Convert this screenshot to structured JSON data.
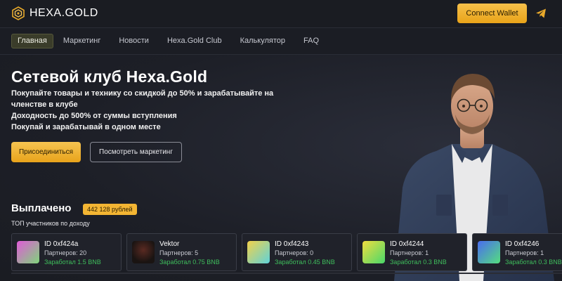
{
  "brand": {
    "name": "HEXA.GOLD",
    "accent": "#f0b030"
  },
  "header": {
    "connect_label": "Connect Wallet"
  },
  "nav": {
    "items": [
      {
        "label": "Главная",
        "active": true
      },
      {
        "label": "Маркетинг",
        "active": false
      },
      {
        "label": "Новости",
        "active": false
      },
      {
        "label": "Hexa.Gold Club",
        "active": false
      },
      {
        "label": "Калькулятор",
        "active": false
      },
      {
        "label": "FAQ",
        "active": false
      }
    ]
  },
  "hero": {
    "title": "Сетевой клуб Hexa.Gold",
    "line1": "Покупайте товары и технику со скидкой до 50% и зарабатывайте на",
    "line2": "членстве в клубе",
    "line3": "Доходность до 500% от суммы вступления",
    "line4": "Покупай и зарабатывай в одном месте",
    "join_label": "Присоединиться",
    "marketing_label": "Посмотреть маркетинг"
  },
  "paid": {
    "title": "Выплачено",
    "amount": "442 128 рублей",
    "subtitle": "ТОП участников по доходу"
  },
  "top_members": [
    {
      "id": "ID 0xf424a",
      "partners": "Партнеров: 20",
      "earned": "Заработал 1.5 BNB",
      "avatar": "gradient-pink-green"
    },
    {
      "id": "Vektor",
      "partners": "Партнеров: 5",
      "earned": "Заработал 0.75 BNB",
      "avatar": "photo-dark"
    },
    {
      "id": "ID 0xf4243",
      "partners": "Партнеров: 0",
      "earned": "Заработал 0.45 BNB",
      "avatar": "gradient-yellow-cyan"
    },
    {
      "id": "ID 0xf4244",
      "partners": "Партнеров: 1",
      "earned": "Заработал 0.3 BNB",
      "avatar": "gradient-yellow-green"
    },
    {
      "id": "ID 0xf4246",
      "partners": "Партнеров: 1",
      "earned": "Заработал 0.3 BNB",
      "avatar": "gradient-blue-green"
    }
  ]
}
